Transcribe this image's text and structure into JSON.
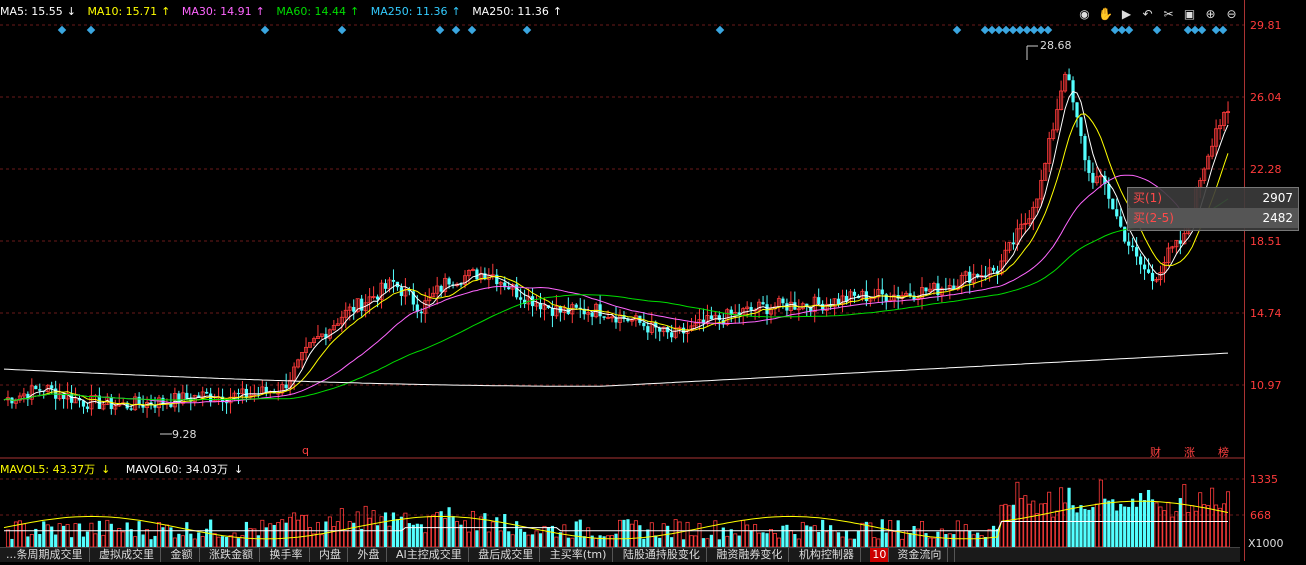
{
  "ma_legend": [
    {
      "label": "MA5: 15.55",
      "arrow": "↓",
      "color": "#ffffff"
    },
    {
      "label": "MA10: 15.71",
      "arrow": "↑",
      "color": "#ffff00"
    },
    {
      "label": "MA30: 14.91",
      "arrow": "↑",
      "color": "#ff66ff"
    },
    {
      "label": "MA60: 14.44",
      "arrow": "↑",
      "color": "#00dd00"
    },
    {
      "label": "MA250: 11.36",
      "arrow": "↑",
      "color": "#33ccff"
    },
    {
      "label": "MA250: 11.36",
      "arrow": "↑",
      "color": "#ffffff"
    }
  ],
  "vol_legend": [
    {
      "label": "MAVOL5: 43.37万",
      "arrow": "↓",
      "color": "#ffff00"
    },
    {
      "label": "MAVOL60: 34.03万",
      "arrow": "↓",
      "color": "#ffffff"
    }
  ],
  "price_axis": [
    "29.81",
    "26.04",
    "22.28",
    "18.51",
    "14.74",
    "10.97"
  ],
  "volume_axis": [
    "1335",
    "668"
  ],
  "volume_unit": "X1000",
  "high_label": "28.68",
  "low_label": "9.28",
  "markers": {
    "q": "q",
    "cai": "财",
    "zhang": "涨",
    "bang": "榜"
  },
  "popup": {
    "rows": [
      {
        "label": "买(1)",
        "value": "2907"
      },
      {
        "label": "买(2-5)",
        "value": "2482"
      }
    ]
  },
  "toolbar_icons": [
    "eye-icon",
    "hand-icon",
    "play-icon",
    "undo-icon",
    "scissors-icon",
    "layout-icon",
    "zoom-in-icon",
    "zoom-out-icon"
  ],
  "tabs": [
    {
      "label": "...条周期成交里"
    },
    {
      "label": "虚拟成交里"
    },
    {
      "label": "金额"
    },
    {
      "label": "涨跌金额"
    },
    {
      "label": "换手率"
    },
    {
      "label": "内盘"
    },
    {
      "label": "外盘"
    },
    {
      "label": "AI主控成交里"
    },
    {
      "label": "盘后成交里"
    },
    {
      "label": "主买率(tm)"
    },
    {
      "label": "陆股通持股变化"
    },
    {
      "label": "融资融券变化"
    },
    {
      "label": "机构控制器"
    },
    {
      "label": "资金流向"
    }
  ],
  "colors": {
    "up": "#ff3b3b",
    "down": "#54ffff",
    "ma5": "#ffffff",
    "ma10": "#ffff00",
    "ma30": "#ff66ff",
    "ma60": "#00dd00",
    "ma250": "#ffffff"
  }
}
